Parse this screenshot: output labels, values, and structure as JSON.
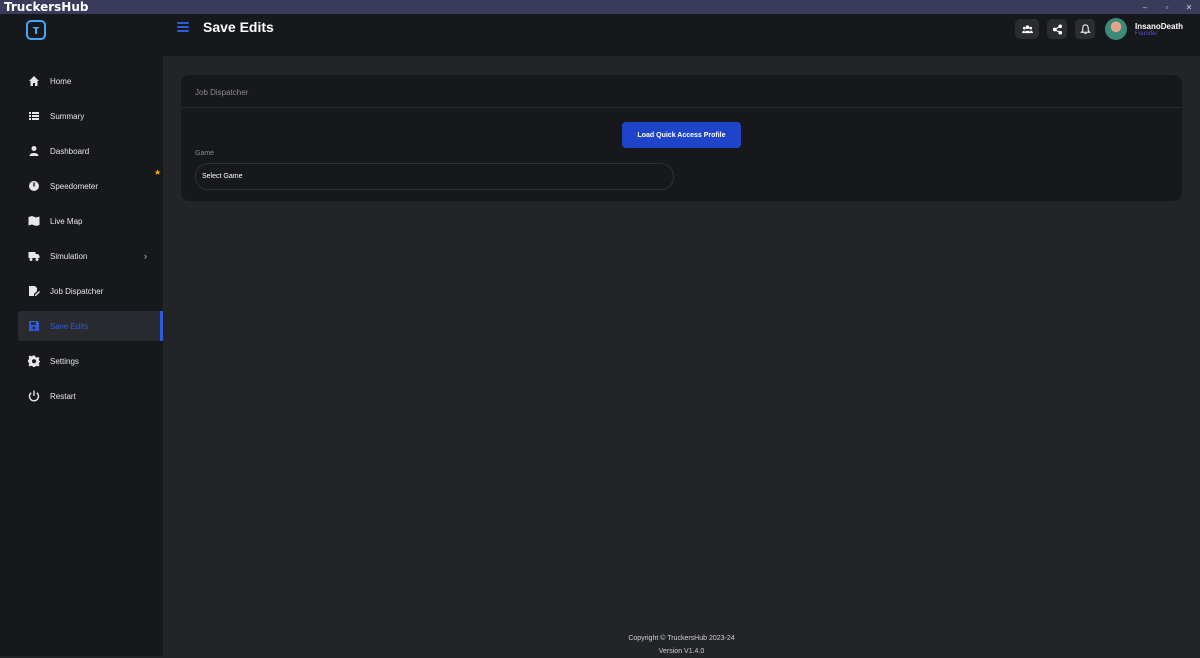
{
  "window": {
    "title": "TruckersHub",
    "controls": [
      "–",
      "▫",
      "✕"
    ]
  },
  "sidebar": {
    "logo_icon": "hook-logo-icon",
    "items": [
      {
        "label": "Home",
        "icon": "home-icon",
        "active": false
      },
      {
        "label": "Summary",
        "icon": "list-icon",
        "active": false
      },
      {
        "label": "Dashboard",
        "icon": "user-icon",
        "active": false
      },
      {
        "label": "Speedometer",
        "icon": "gauge-icon",
        "active": false
      },
      {
        "label": "Live Map",
        "icon": "map-icon",
        "active": false
      },
      {
        "label": "Simulation",
        "icon": "truck-icon",
        "active": false,
        "chevron": "›"
      },
      {
        "label": "Job Dispatcher",
        "icon": "file-edit-icon",
        "active": false
      },
      {
        "label": "Save Edits",
        "icon": "floppy-icon",
        "active": true
      },
      {
        "label": "Settings",
        "icon": "gear-icon",
        "active": false
      },
      {
        "label": "Restart",
        "icon": "power-icon",
        "active": false
      }
    ],
    "star": "★"
  },
  "header": {
    "title": "Save Edits",
    "user": {
      "name": "InsanoDeath",
      "role": "Founder"
    }
  },
  "card": {
    "title": "Job Dispatcher",
    "load_button": "Load Quick Access Profile",
    "game_label": "Game",
    "game_select_value": "Select Game"
  },
  "footer": {
    "copyright": "Copyright © TruckersHub 2023-24",
    "version": "Version V1.4.0"
  },
  "colors": {
    "accent": "#2f5bd8",
    "button": "#1e44c9",
    "sidebar_bg": "#17181b",
    "main_bg": "#232428"
  }
}
